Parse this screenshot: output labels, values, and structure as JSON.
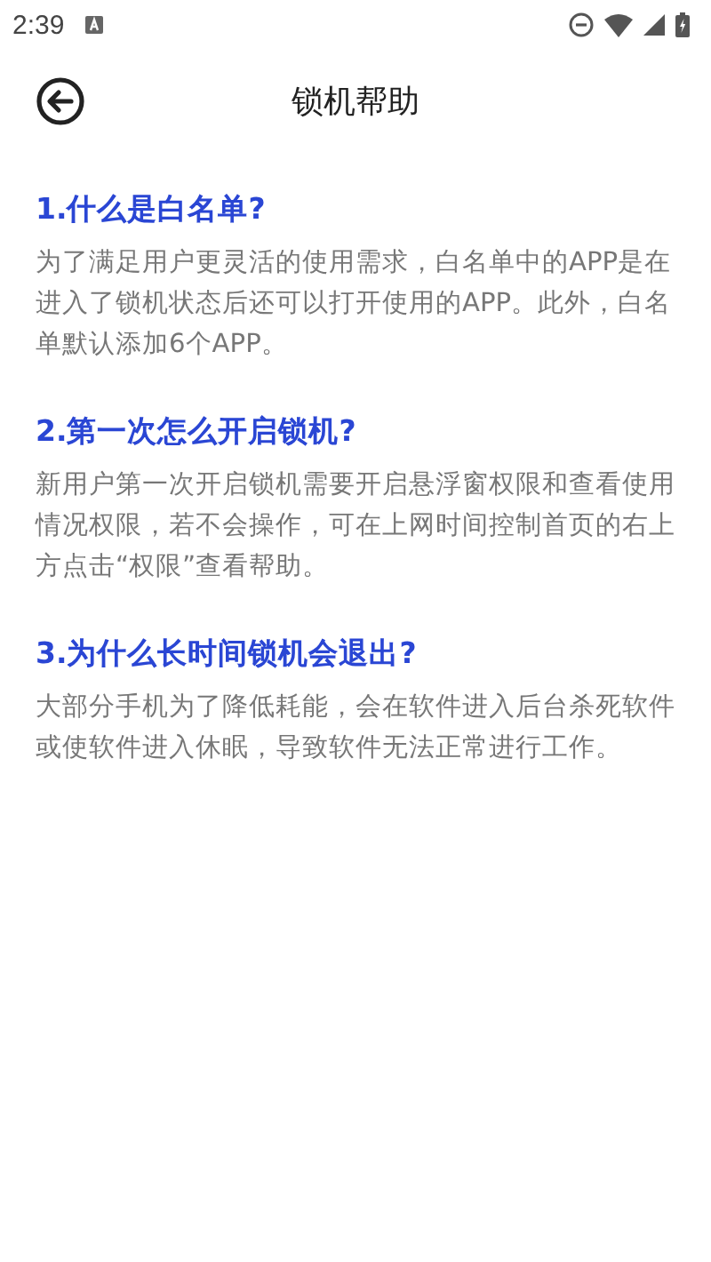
{
  "status_bar": {
    "time": "2:39"
  },
  "header": {
    "title": "锁机帮助"
  },
  "sections": [
    {
      "question": "1.什么是白名单?",
      "answer": "为了满足用户更灵活的使用需求，白名单中的APP是在进入了锁机状态后还可以打开使用的APP。此外，白名单默认添加6个APP。"
    },
    {
      "question": "2.第一次怎么开启锁机?",
      "answer": "新用户第一次开启锁机需要开启悬浮窗权限和查看使用情况权限，若不会操作，可在上网时间控制首页的右上方点击“权限”查看帮助。"
    },
    {
      "question": "3.为什么长时间锁机会退出?",
      "answer": "大部分手机为了降低耗能，会在软件进入后台杀死软件或使软件进入休眠，导致软件无法正常进行工作。"
    }
  ]
}
